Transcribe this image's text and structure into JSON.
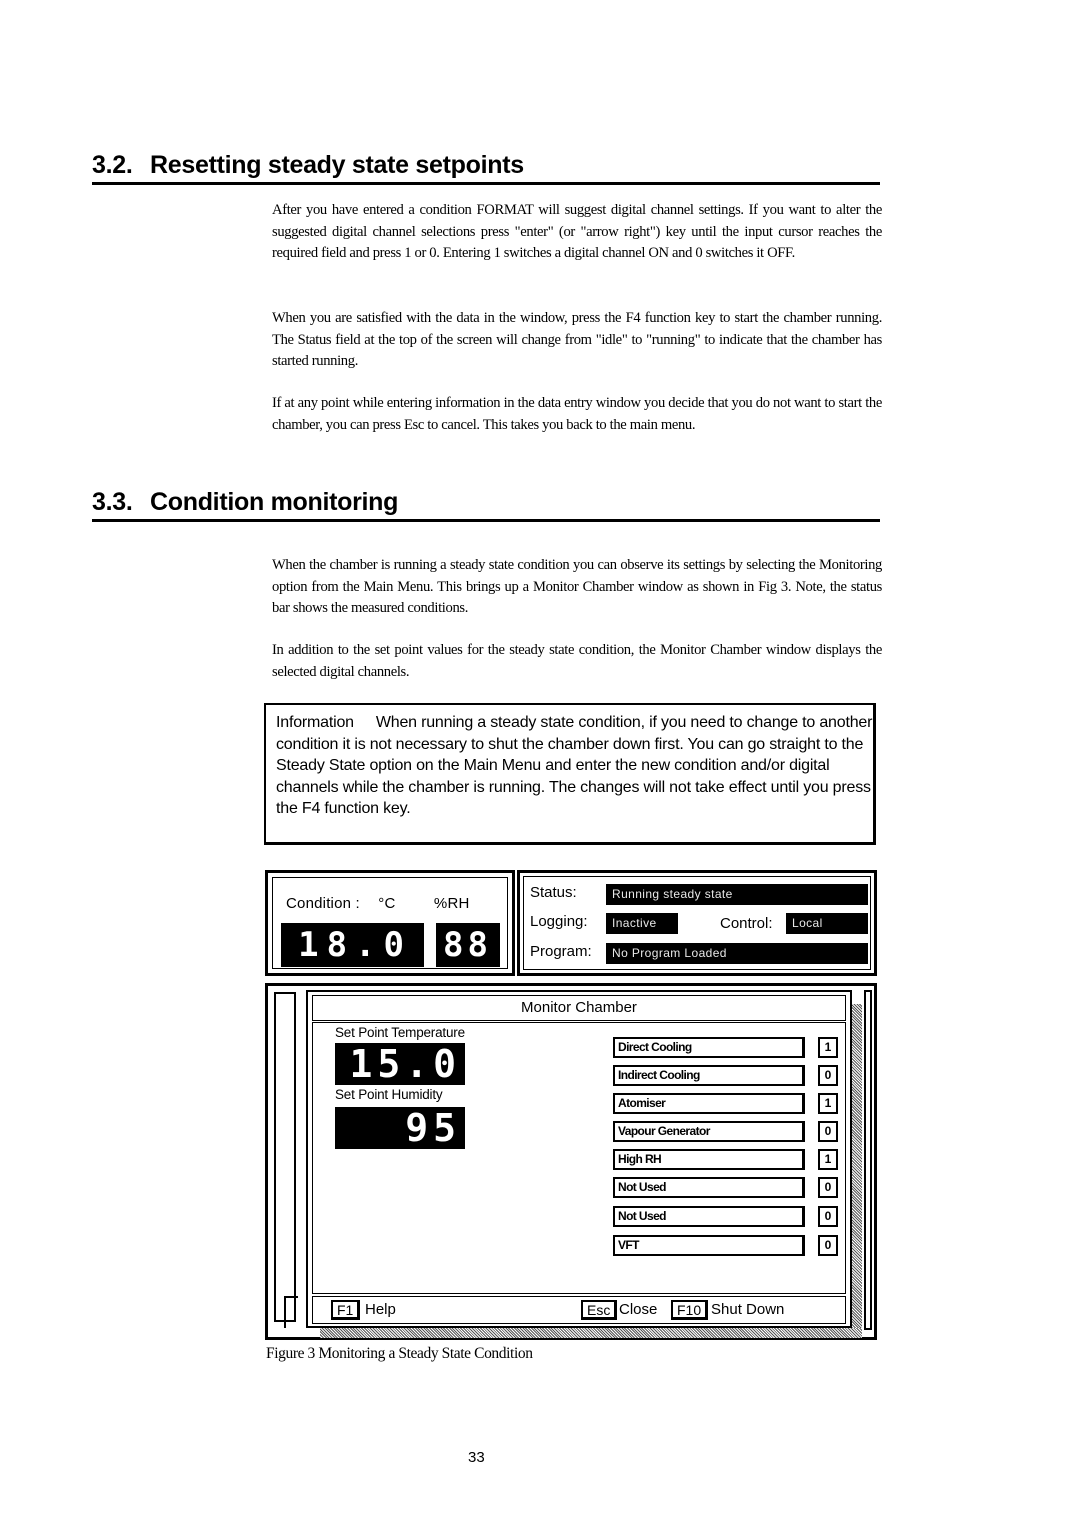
{
  "sections": [
    {
      "number": "3.2.",
      "title": "Resetting steady state setpoints",
      "paragraphs": [
        "After you have entered a condition FORMAT will suggest digital channel settings. If you want to alter the suggested digital channel selections press \"enter\" (or \"arrow right\") key until the input cursor reaches the required field and press 1 or 0. Entering 1 switches a digital channel ON and 0 switches it OFF.",
        "When you are satisfied with the data in the window, press the F4 function key to start the chamber running.  The Status field at the top of the screen will change from \"idle\" to \"running\" to indicate that the chamber has started running.",
        "If at any point while entering information in the data entry window you decide that you do not want to start the chamber, you can press Esc to cancel.  This takes you back to the main menu."
      ]
    },
    {
      "number": "3.3.",
      "title": "Condition monitoring",
      "paragraphs": [
        "When the chamber is running a steady state condition you can observe its settings by selecting the Monitoring option from the Main Menu.  This brings up a Monitor Chamber window as shown in Fig 3. Note, the status bar shows the measured conditions.",
        "In addition to the set point values for the steady state condition, the Monitor Chamber window displays the selected digital channels."
      ]
    }
  ],
  "info_box": {
    "label": "Information",
    "text": "When running a steady state condition, if you need to change to another condition it is not necessary to shut the chamber down first.  You can go straight to the Steady State option on the Main Menu and enter the new condition and/or digital channels while the chamber is running.  The changes will not take effect until you press the F4 function key."
  },
  "figure": {
    "condition": {
      "label": "Condition :",
      "temp_unit": "°C",
      "rh_unit": "%RH",
      "temp_value": "18.0",
      "rh_value": "88"
    },
    "status": {
      "status_label": "Status:",
      "status_value": "Running steady state",
      "logging_label": "Logging:",
      "logging_value": "Inactive",
      "control_label": "Control:",
      "control_value": "Local",
      "program_label": "Program:",
      "program_value": "No Program Loaded"
    },
    "window": {
      "title": "Monitor Chamber",
      "setpoint_temp_label": "Set Point Temperature",
      "setpoint_temp_value": "15.0",
      "setpoint_humidity_label": "Set Point Humidity",
      "setpoint_humidity_value": "95",
      "channels": [
        {
          "name": "Direct Cooling",
          "value": "1"
        },
        {
          "name": "Indirect Cooling",
          "value": "0"
        },
        {
          "name": "Atomiser",
          "value": "1"
        },
        {
          "name": "Vapour Generator",
          "value": "0"
        },
        {
          "name": "High RH",
          "value": "1"
        },
        {
          "name": "Not Used",
          "value": "0"
        },
        {
          "name": "Not Used",
          "value": "0"
        },
        {
          "name": "VFT",
          "value": "0"
        }
      ],
      "footer": {
        "help_key": "F1",
        "help_label": "Help",
        "close_key": "Esc",
        "close_label": "Close",
        "shutdown_key": "F10",
        "shutdown_label": "Shut Down"
      }
    },
    "caption": "Figure 3 Monitoring a Steady State Condition"
  },
  "page_number": "33"
}
